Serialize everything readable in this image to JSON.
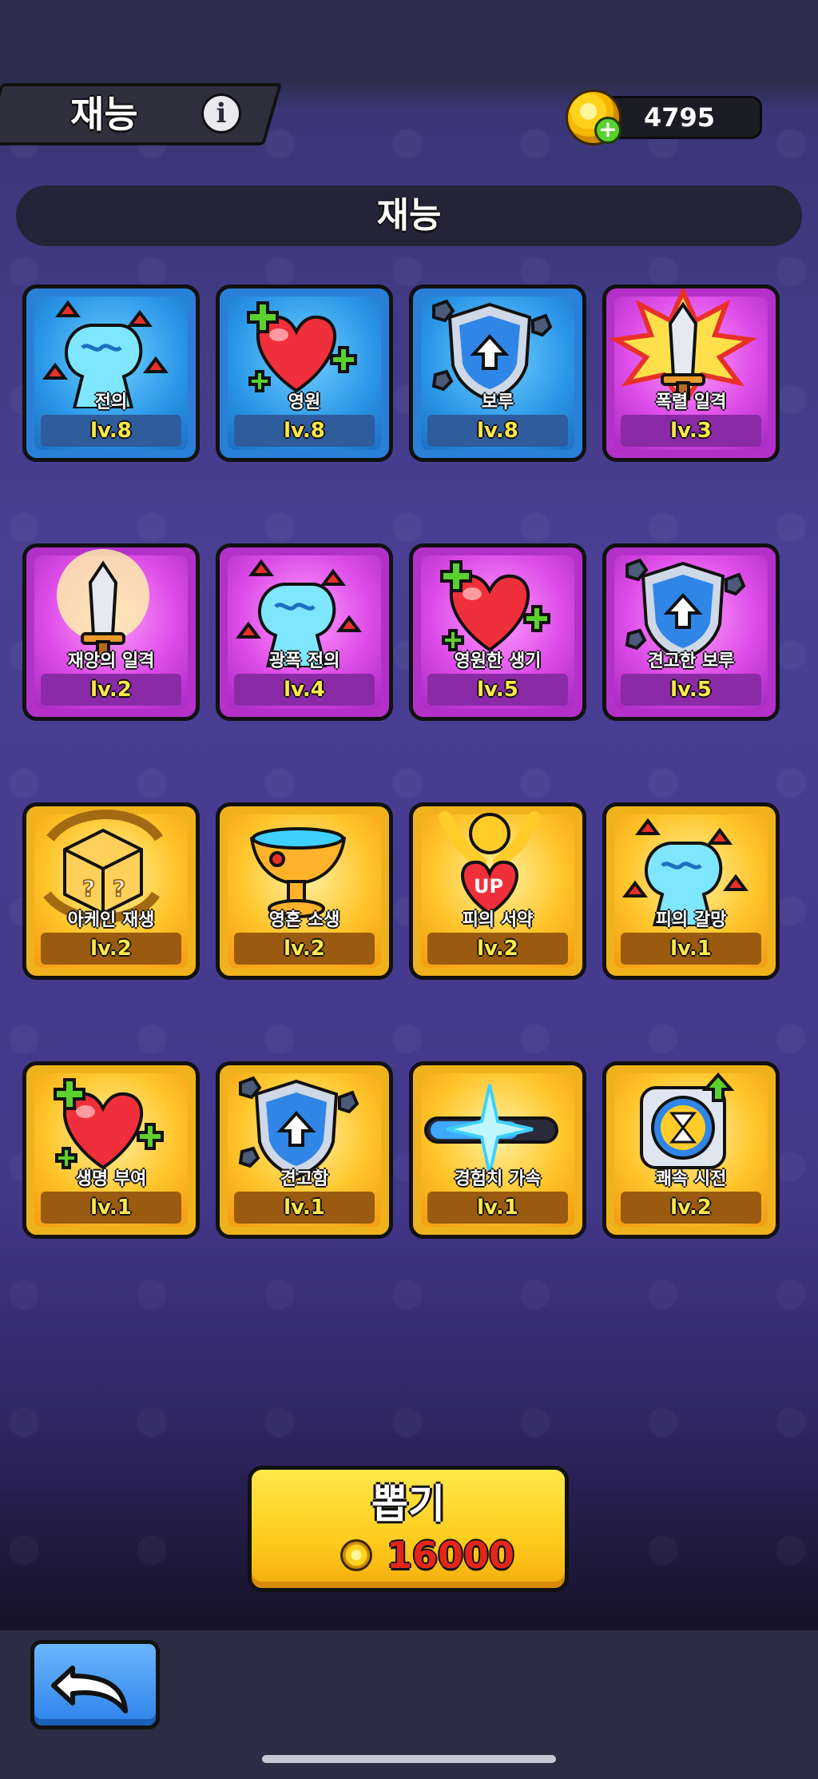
{
  "header": {
    "title": "재능",
    "info_icon": "info-icon",
    "coins": "4795"
  },
  "section": {
    "title": "재능"
  },
  "cards": [
    {
      "name": "전의",
      "level": "lv.8",
      "tier": "blue",
      "icon": "fist-icon"
    },
    {
      "name": "영원",
      "level": "lv.8",
      "tier": "blue",
      "icon": "heart-icon"
    },
    {
      "name": "보루",
      "level": "lv.8",
      "tier": "blue",
      "icon": "shield-icon"
    },
    {
      "name": "폭렬 일격",
      "level": "lv.3",
      "tier": "purple",
      "icon": "sword-burst-icon"
    },
    {
      "name": "재앙의 일격",
      "level": "lv.2",
      "tier": "purple",
      "icon": "sword-glow-icon"
    },
    {
      "name": "광폭 전의",
      "level": "lv.4",
      "tier": "purple",
      "icon": "fist-icon"
    },
    {
      "name": "영원한 생기",
      "level": "lv.5",
      "tier": "purple",
      "icon": "heart-icon"
    },
    {
      "name": "견고한 보루",
      "level": "lv.5",
      "tier": "purple",
      "icon": "shield-icon"
    },
    {
      "name": "아케인 재생",
      "level": "lv.2",
      "tier": "gold",
      "icon": "dice-icon"
    },
    {
      "name": "영혼 소생",
      "level": "lv.2",
      "tier": "gold",
      "icon": "chalice-icon"
    },
    {
      "name": "피의 서약",
      "level": "lv.2",
      "tier": "gold",
      "icon": "pledge-icon",
      "badge": "UP"
    },
    {
      "name": "피의 갈망",
      "level": "lv.1",
      "tier": "gold",
      "icon": "fist-icon"
    },
    {
      "name": "생명 부여",
      "level": "lv.1",
      "tier": "gold",
      "icon": "heart-icon"
    },
    {
      "name": "견고함",
      "level": "lv.1",
      "tier": "gold",
      "icon": "shield-icon"
    },
    {
      "name": "경험치 가속",
      "level": "lv.1",
      "tier": "gold",
      "icon": "exp-bar-icon"
    },
    {
      "name": "쾌속 시전",
      "level": "lv.2",
      "tier": "gold",
      "icon": "hourglass-icon"
    }
  ],
  "draw_button": {
    "label": "뽑기",
    "cost": "16000"
  },
  "colors": {
    "blue_tier": "#2a7fd8",
    "purple_tier": "#b431c9",
    "gold_tier": "#f0b21c",
    "level_text": "#ffe84a",
    "cost_text": "#e2261a"
  }
}
